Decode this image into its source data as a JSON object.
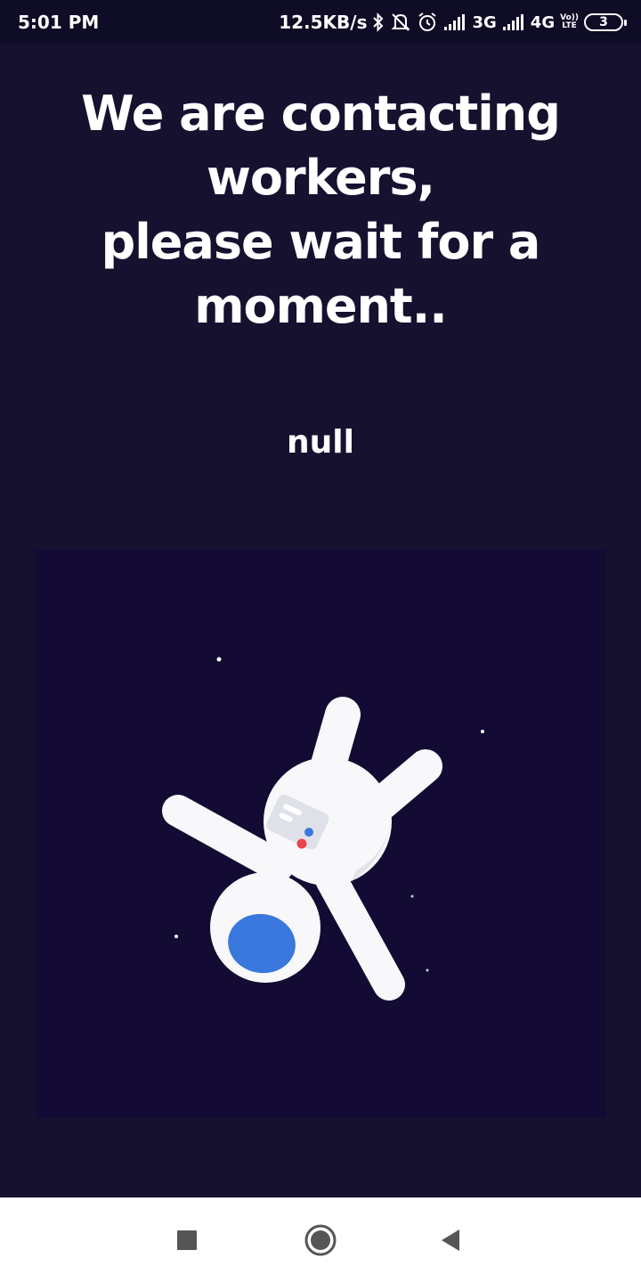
{
  "status_bar": {
    "time": "5:01 PM",
    "speed": "12.5KB/s",
    "net1": "3G",
    "net2": "4G",
    "volte_top": "Vo))",
    "volte_bottom": "LTE",
    "battery": "3",
    "icons": [
      "bluetooth-icon",
      "mute-icon",
      "alarm-icon",
      "signal-icon",
      "signal-icon",
      "battery-icon"
    ]
  },
  "main": {
    "headline_lines": [
      "We are contacting",
      "workers,",
      "please wait for a",
      "moment.."
    ],
    "status_value": "null",
    "illustration": "astronaut-floating"
  },
  "nav": {
    "icons": [
      "recents-square-icon",
      "home-circle-icon",
      "back-triangle-icon"
    ]
  },
  "colors": {
    "background": "#15112f",
    "illustration_bg": "#130b33",
    "astronaut": "#f8f8fa",
    "visor": "#3a78de",
    "accent_red": "#e8434f"
  }
}
